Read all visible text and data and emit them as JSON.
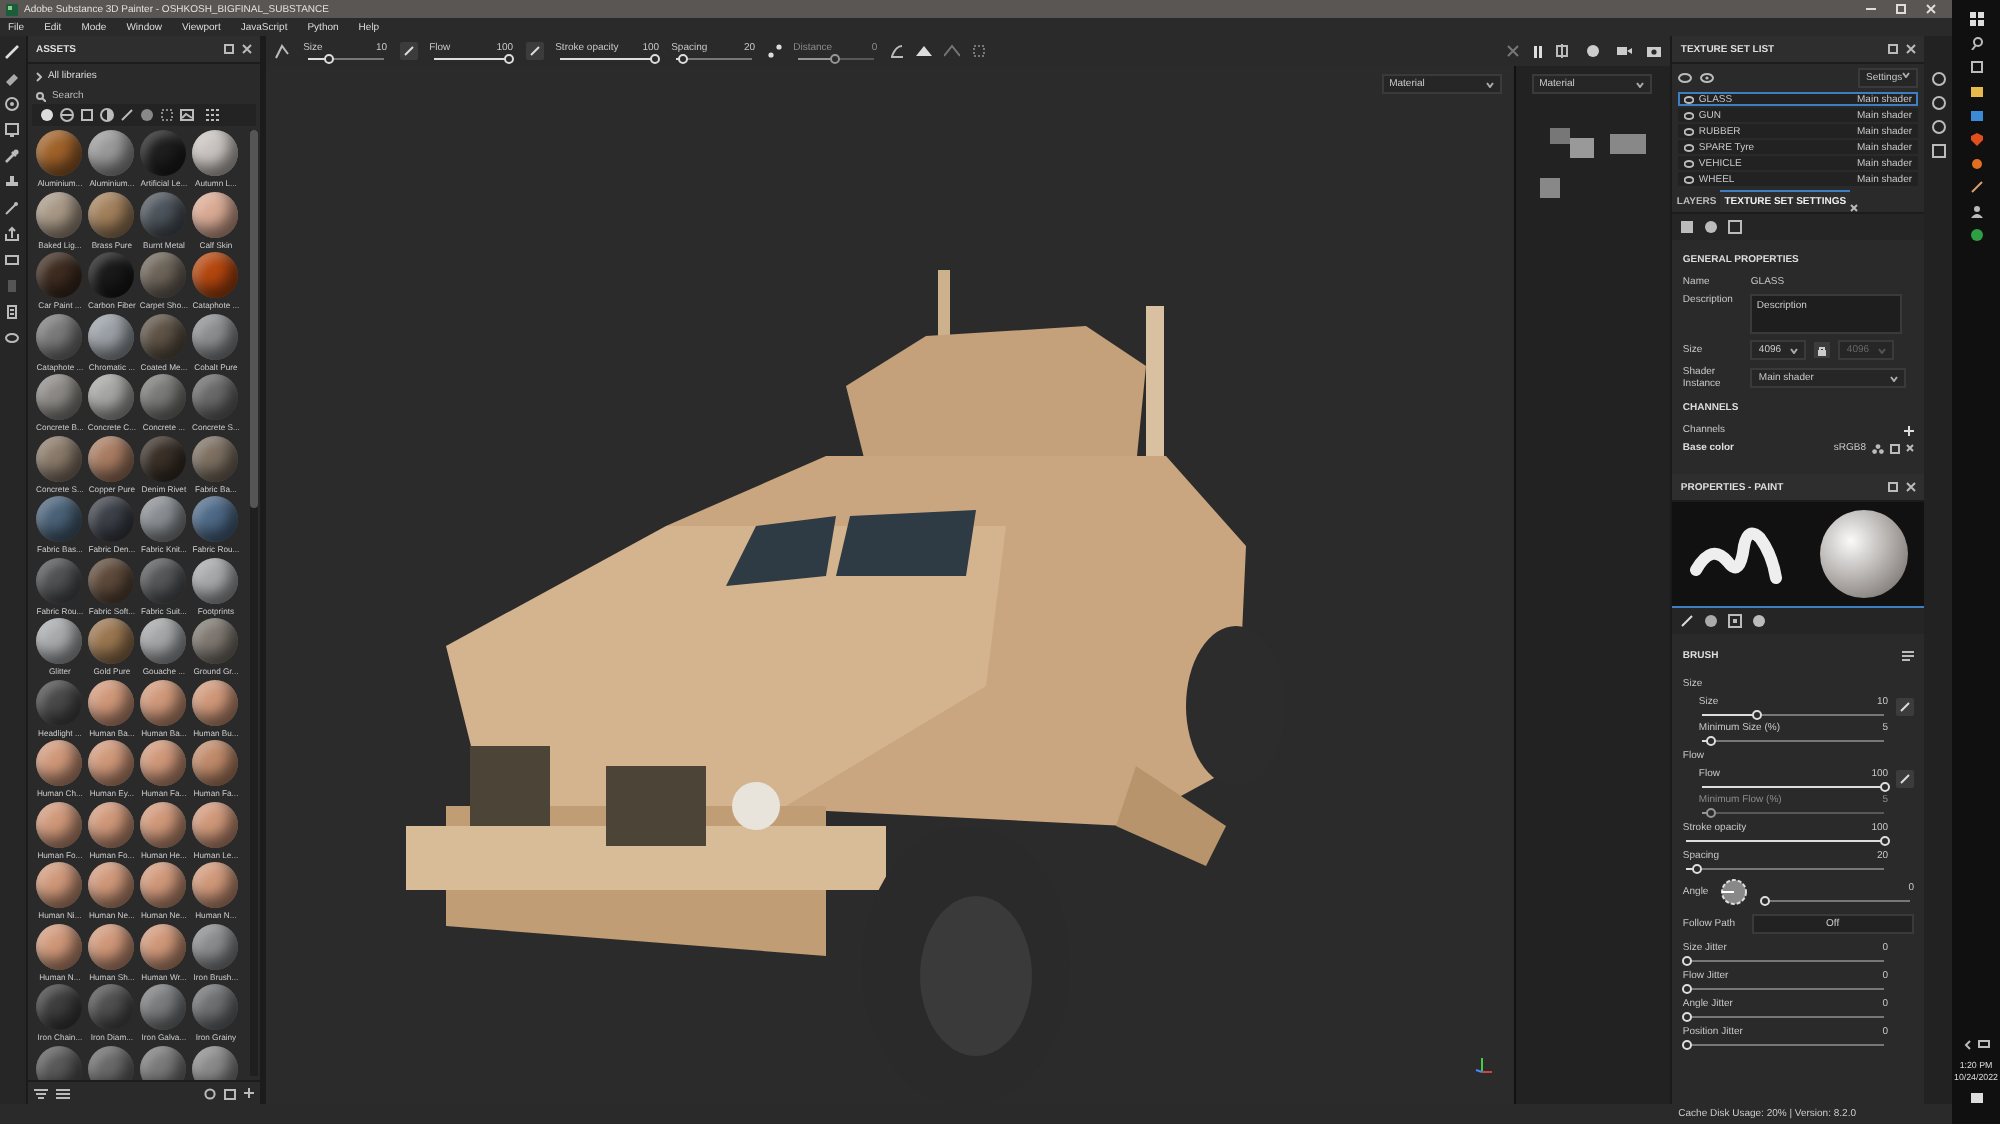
{
  "window": {
    "title": "Adobe Substance 3D Painter - OSHKOSH_BIGFINAL_SUBSTANCE"
  },
  "menu": [
    "File",
    "Edit",
    "Mode",
    "Window",
    "Viewport",
    "JavaScript",
    "Python",
    "Help"
  ],
  "assets": {
    "title": "ASSETS",
    "breadcrumb": "All libraries",
    "search_placeholder": "Search",
    "materials": [
      {
        "name": "Aluminium...",
        "color": "#a0622a"
      },
      {
        "name": "Aluminium...",
        "color": "#9a9a9a"
      },
      {
        "name": "Artificial Le...",
        "color": "#1e1e1e"
      },
      {
        "name": "Autumn L...",
        "color": "#c9c4c0"
      },
      {
        "name": "Baked Lig...",
        "color": "#a89886"
      },
      {
        "name": "Brass Pure",
        "color": "#a2805c"
      },
      {
        "name": "Burnt Metal",
        "color": "#4d545c"
      },
      {
        "name": "Calf Skin",
        "color": "#d9aa94"
      },
      {
        "name": "Car Paint ...",
        "color": "#3e2c20"
      },
      {
        "name": "Carbon Fiber",
        "color": "#1a1a1a"
      },
      {
        "name": "Carpet Sho...",
        "color": "#6e655a"
      },
      {
        "name": "Cataphote ...",
        "color": "#b4470f"
      },
      {
        "name": "Cataphote ...",
        "color": "#7a7a7a"
      },
      {
        "name": "Chromatic ...",
        "color": "#9aa0a6"
      },
      {
        "name": "Coated Me...",
        "color": "#5e5346"
      },
      {
        "name": "Cobalt Pure",
        "color": "#8c8e90"
      },
      {
        "name": "Concrete B...",
        "color": "#8d8a86"
      },
      {
        "name": "Concrete C...",
        "color": "#a6a6a4"
      },
      {
        "name": "Concrete ...",
        "color": "#7a7a78"
      },
      {
        "name": "Concrete S...",
        "color": "#6a6a6a"
      },
      {
        "name": "Concrete S...",
        "color": "#8a7a6a"
      },
      {
        "name": "Copper Pure",
        "color": "#a87c62"
      },
      {
        "name": "Denim Rivet",
        "color": "#3a3028"
      },
      {
        "name": "Fabric Ba...",
        "color": "#7d7062"
      },
      {
        "name": "Fabric Bas...",
        "color": "#4a6278"
      },
      {
        "name": "Fabric Den...",
        "color": "#3c4048"
      },
      {
        "name": "Fabric Knit...",
        "color": "#8a8e92"
      },
      {
        "name": "Fabric Rou...",
        "color": "#4e6a88"
      },
      {
        "name": "Fabric Rou...",
        "color": "#505254"
      },
      {
        "name": "Fabric Soft...",
        "color": "#5e4a3a"
      },
      {
        "name": "Fabric Suit...",
        "color": "#55585a"
      },
      {
        "name": "Footprints",
        "color": "#a6a8aa"
      },
      {
        "name": "Glitter",
        "color": "#a8aaac"
      },
      {
        "name": "Gold Pure",
        "color": "#9a7650"
      },
      {
        "name": "Gouache ...",
        "color": "#a4a6a8"
      },
      {
        "name": "Ground Gr...",
        "color": "#7e7870"
      },
      {
        "name": "Headlight ...",
        "color": "#4a4a4a"
      },
      {
        "name": "Human Ba...",
        "color": "#d0987a"
      },
      {
        "name": "Human Ba...",
        "color": "#d0987a"
      },
      {
        "name": "Human Bu...",
        "color": "#d0987a"
      },
      {
        "name": "Human Ch...",
        "color": "#d0987a"
      },
      {
        "name": "Human Ey...",
        "color": "#d0987a"
      },
      {
        "name": "Human Fa...",
        "color": "#d0987a"
      },
      {
        "name": "Human Fa...",
        "color": "#c08a6a"
      },
      {
        "name": "Human Fo...",
        "color": "#d0987a"
      },
      {
        "name": "Human Fo...",
        "color": "#d0987a"
      },
      {
        "name": "Human He...",
        "color": "#d0987a"
      },
      {
        "name": "Human Le...",
        "color": "#d0987a"
      },
      {
        "name": "Human Ni...",
        "color": "#d0987a"
      },
      {
        "name": "Human Ne...",
        "color": "#d0987a"
      },
      {
        "name": "Human Ne...",
        "color": "#d0987a"
      },
      {
        "name": "Human N...",
        "color": "#d0987a"
      },
      {
        "name": "Human N...",
        "color": "#d0987a"
      },
      {
        "name": "Human Sh...",
        "color": "#d0987a"
      },
      {
        "name": "Human Wr...",
        "color": "#d0987a"
      },
      {
        "name": "Iron Brush...",
        "color": "#8a8c8e"
      },
      {
        "name": "Iron Chain...",
        "color": "#3e3e3e"
      },
      {
        "name": "Iron Diam...",
        "color": "#505050"
      },
      {
        "name": "Iron Galva...",
        "color": "#7a7c7e"
      },
      {
        "name": "Iron Grainy",
        "color": "#6e7072"
      },
      {
        "color": "#5a5a5a"
      },
      {
        "color": "#6a6a6a"
      },
      {
        "color": "#7a7a7a"
      },
      {
        "color": "#8a8a8a"
      }
    ]
  },
  "toolbar": {
    "sliders": [
      {
        "label": "Size",
        "reading": "10",
        "level": 0.3,
        "disabled": false
      },
      {
        "label": "Flow",
        "reading": "100",
        "level": 1,
        "disabled": false
      },
      {
        "label": "Stroke opacity",
        "reading": "100",
        "level": 1,
        "disabled": false
      },
      {
        "label": "Spacing",
        "reading": "20",
        "level": 0.1,
        "disabled": false
      },
      {
        "label": "Distance",
        "reading": "0",
        "level": 0.5,
        "disabled": true
      }
    ]
  },
  "viewport": {
    "mode": "Material"
  },
  "uv_view": {
    "mode": "Material"
  },
  "texture_set_list": {
    "title": "TEXTURE SET LIST",
    "settings": "Settings",
    "sets": [
      {
        "name": "GLASS",
        "shader": "Main shader",
        "selected": true
      },
      {
        "name": "GUN",
        "shader": "Main shader",
        "selected": false
      },
      {
        "name": "RUBBER",
        "shader": "Main shader",
        "selected": false
      },
      {
        "name": "SPARE Tyre",
        "shader": "Main shader",
        "selected": false
      },
      {
        "name": "VEHICLE",
        "shader": "Main shader",
        "selected": false
      },
      {
        "name": "WHEEL",
        "shader": "Main shader",
        "selected": false
      }
    ]
  },
  "settings_tabs": [
    {
      "label": "LAYERS",
      "selected": false
    },
    {
      "label": "TEXTURE SET SETTINGS",
      "selected": true
    }
  ],
  "general": {
    "title": "GENERAL PROPERTIES",
    "name_label": "Name",
    "name_value": "GLASS",
    "description_label": "Description",
    "description_placeholder": "Description",
    "size_label": "Size",
    "size_value": "4096",
    "size_value_linked": "4096",
    "shader_label": "Shader Instance",
    "shader_value": "Main shader"
  },
  "channels": {
    "title": "CHANNELS",
    "label": "Channels",
    "items": [
      {
        "name": "Base color",
        "format": "sRGB8"
      }
    ]
  },
  "properties": {
    "title": "PROPERTIES - PAINT",
    "section": "BRUSH",
    "rows": [
      {
        "kind": "group",
        "label": "Size",
        "children": [
          {
            "kind": "slider",
            "label": "Size",
            "reading": "10",
            "level": 0.3,
            "disabled": false
          },
          {
            "kind": "slider",
            "label": "Minimum Size (%)",
            "reading": "5",
            "level": 0.05,
            "disabled": false
          }
        ]
      },
      {
        "kind": "group",
        "label": "Flow",
        "children": [
          {
            "kind": "slider",
            "label": "Flow",
            "reading": "100",
            "level": 1,
            "disabled": false
          },
          {
            "kind": "slider",
            "label": "Minimum Flow (%)",
            "reading": "5",
            "level": 0.05,
            "disabled": true
          }
        ]
      },
      {
        "kind": "slider",
        "label": "Stroke opacity",
        "reading": "100",
        "level": 1,
        "disabled": false
      },
      {
        "kind": "slider",
        "label": "Spacing",
        "reading": "20",
        "level": 0.05,
        "disabled": false
      },
      {
        "kind": "angle",
        "label": "Angle",
        "reading": "0",
        "level": 0
      },
      {
        "kind": "toggle",
        "label": "Follow Path",
        "value": "Off"
      },
      {
        "kind": "slider",
        "label": "Size Jitter",
        "reading": "0",
        "level": 0,
        "disabled": false
      },
      {
        "kind": "slider",
        "label": "Flow Jitter",
        "reading": "0",
        "level": 0,
        "disabled": false
      },
      {
        "kind": "slider",
        "label": "Angle Jitter",
        "reading": "0",
        "level": 0,
        "disabled": false
      },
      {
        "kind": "slider",
        "label": "Position Jitter",
        "reading": "0",
        "level": 0,
        "disabled": false
      }
    ]
  },
  "status_bar": {
    "text": "Cache Disk Usage:  20% | Version: 8.2.0"
  },
  "taskbar": {
    "time": "1:20 PM",
    "date": "10/24/2022"
  }
}
